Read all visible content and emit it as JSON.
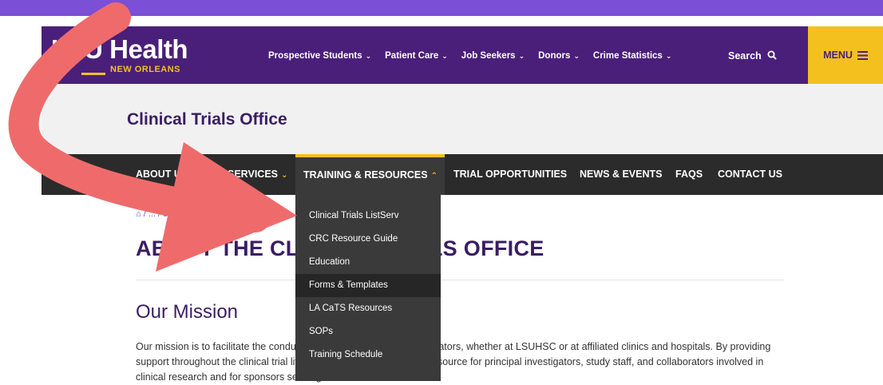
{
  "colors": {
    "purple": "#4a1f7a",
    "gold": "#f4c01e",
    "dark_nav": "#2b2b2b",
    "arrow": "#ef6b6b",
    "top_band": "#7b4fd6"
  },
  "header": {
    "logo_main": "LSU Health",
    "logo_sub": "NEW ORLEANS",
    "nav": [
      {
        "label": "Prospective Students",
        "chevron": "⌄"
      },
      {
        "label": "Patient Care",
        "chevron": "⌄"
      },
      {
        "label": "Job Seekers",
        "chevron": "⌄"
      },
      {
        "label": "Donors",
        "chevron": "⌄"
      },
      {
        "label": "Crime Statistics",
        "chevron": "⌄"
      }
    ],
    "search_label": "Search",
    "search_icon": "search-icon",
    "menu_label": "MENU",
    "menu_icon": "hamburger-icon"
  },
  "site_title": "Clinical Trials Office",
  "sub_nav": [
    {
      "label": "ABOUT US"
    },
    {
      "label": "SERVICES"
    },
    {
      "label": "TRAINING & RESOURCES"
    },
    {
      "label": "TRIAL OPPORTUNITIES"
    },
    {
      "label": "NEWS & EVENTS"
    },
    {
      "label": "FAQS"
    },
    {
      "label": "CONTACT US"
    }
  ],
  "chevron_down": "⌄",
  "chevron_up": "⌃",
  "dropdown": [
    "Clinical Trials ListServ",
    "CRC Resource Guide",
    "Education",
    "Forms & Templates",
    "LA CaTS Resources",
    "SOPs",
    "Training Schedule"
  ],
  "breadcrumb": "⌂  /  ...  /  c",
  "page_heading": "ABOUT THE CLINICAL TRIALS OFFICE",
  "mission_heading": "Our Mission",
  "mission_text": "Our mission is to facilitate the conduct of clinical trials by our investigators, whether at LSUHSC or at affiliated clinics and hospitals. By providing support throughout the clinical trial lifecycle, we serve as a central resource for principal investigators, study staff, and collaborators involved in clinical research and for sponsors seeking to conduct"
}
